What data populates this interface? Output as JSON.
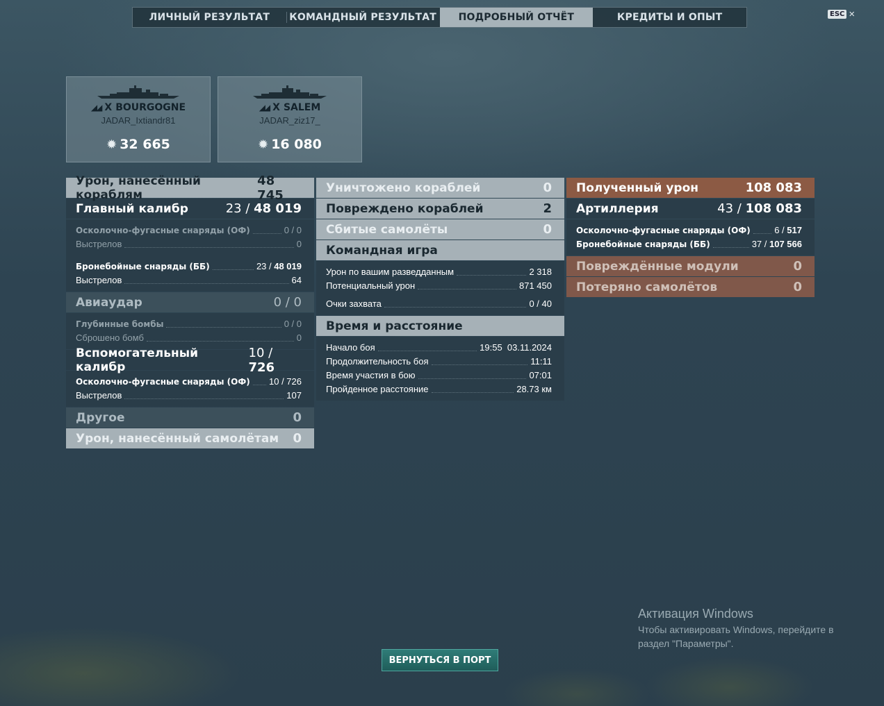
{
  "tabs": [
    {
      "label": "ЛИЧНЫЙ РЕЗУЛЬТАТ",
      "active": false
    },
    {
      "label": "КОМАНДНЫЙ РЕЗУЛЬТАТ",
      "active": false
    },
    {
      "label": "ПОДРОБНЫЙ ОТЧЁТ",
      "active": true
    },
    {
      "label": "КРЕДИТЫ И ОПЫТ",
      "active": false
    }
  ],
  "esc": {
    "key": "ESC",
    "close": "×"
  },
  "ships": [
    {
      "tier": "X",
      "name": "BOURGOGNE",
      "player": "JADAR_Ixtiandr81",
      "score": "32 665"
    },
    {
      "tier": "X",
      "name": "SALEM",
      "player": "JADAR_ziz17_",
      "score": "16 080"
    }
  ],
  "damage": {
    "title": "Урон, нанесённый кораблям",
    "value": "48 745",
    "main_battery": {
      "title": "Главный калибр",
      "hits": "23",
      "value": "48 019"
    },
    "he": {
      "label": "Осколочно-фугасные снаряды (ОФ)",
      "value": "0 / 0"
    },
    "he_shots": {
      "label": "Выстрелов",
      "value": "0"
    },
    "ap": {
      "label": "Бронебойные снаряды (ББ)",
      "hits": "23 / ",
      "value": "48 019"
    },
    "ap_shots": {
      "label": "Выстрелов",
      "value": "64"
    },
    "airstrike": {
      "title": "Авиаудар",
      "value": "0 / 0"
    },
    "depth": {
      "label": "Глубинные бомбы",
      "value": "0 / 0"
    },
    "depth_dropped": {
      "label": "Сброшено бомб",
      "value": "0"
    },
    "secondary": {
      "title": "Вспомогательный калибр",
      "hits": "10",
      "value": "726"
    },
    "sec_he": {
      "label": "Осколочно-фугасные снаряды (ОФ)",
      "value": "10 / 726"
    },
    "sec_shots": {
      "label": "Выстрелов",
      "value": "107"
    },
    "other": {
      "title": "Другое",
      "value": "0"
    },
    "planes": {
      "title": "Урон, нанесённый самолётам",
      "value": "0"
    }
  },
  "middle": {
    "destroyed": {
      "title": "Уничтожено кораблей",
      "value": "0"
    },
    "damaged": {
      "title": "Повреждено кораблей",
      "value": "2"
    },
    "planes_shot": {
      "title": "Сбитые самолёты",
      "value": "0"
    },
    "team": {
      "title": "Командная игра",
      "spotting": {
        "label": "Урон по вашим разведданным",
        "value": "2 318"
      },
      "potential": {
        "label": "Потенциальный урон",
        "value": "871 450"
      },
      "capture": {
        "label": "Очки захвата",
        "value": "0 / 40"
      }
    },
    "time": {
      "title": "Время и расстояние",
      "start": {
        "label": "Начало боя",
        "value": "19:55  03.11.2024"
      },
      "duration": {
        "label": "Продолжительность боя",
        "value": "11:11"
      },
      "participation": {
        "label": "Время участия в бою",
        "value": "07:01"
      },
      "distance": {
        "label": "Пройденное расстояние",
        "value": "28.73 км"
      }
    }
  },
  "received": {
    "title": "Полученный урон",
    "value": "108 083",
    "artillery": {
      "title": "Артиллерия",
      "hits": "43",
      "value": "108 083"
    },
    "he": {
      "label": "Осколочно-фугасные снаряды (ОФ)",
      "hits": "6 / ",
      "value": "517"
    },
    "ap": {
      "label": "Бронебойные снаряды (ББ)",
      "hits": "37 / ",
      "value": "107 566"
    },
    "modules": {
      "title": "Повреждённые модули",
      "value": "0"
    },
    "planes_lost": {
      "title": "Потеряно самолётов",
      "value": "0"
    }
  },
  "port_button": "ВЕРНУТЬСЯ В ПОРТ",
  "watermark": {
    "title": "Активация Windows",
    "text": "Чтобы активировать Windows, перейдите в раздел \"Параметры\"."
  }
}
